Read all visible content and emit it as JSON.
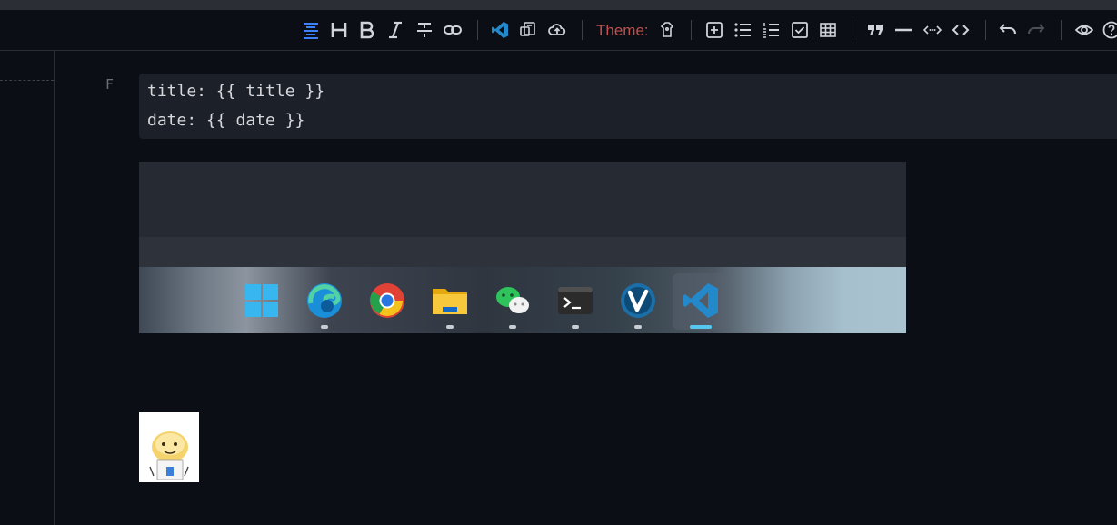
{
  "toolbar": {
    "theme_label": "Theme:",
    "buttons": [
      "align-center-icon",
      "heading-icon",
      "bold-icon",
      "italic-icon",
      "strikethrough-icon",
      "link-icon",
      "vscode-icon",
      "export-icon",
      "upload-cloud-icon",
      "theme-icon",
      "add-snippet-icon",
      "bullet-list-icon",
      "numbered-list-icon",
      "checkbox-icon",
      "table-icon",
      "quote-icon",
      "horizontal-rule-icon",
      "inline-code-icon",
      "code-block-icon",
      "undo-icon",
      "redo-icon",
      "preview-eye-icon",
      "help-icon"
    ]
  },
  "editor": {
    "gutter_marker": "F",
    "code_lines": [
      "title: {{ title }}",
      "date: {{ date }}"
    ]
  },
  "taskbar_image": {
    "apps": [
      {
        "name": "windows-start-icon"
      },
      {
        "name": "edge-icon"
      },
      {
        "name": "chrome-icon"
      },
      {
        "name": "file-explorer-icon"
      },
      {
        "name": "wechat-icon"
      },
      {
        "name": "terminal-icon"
      },
      {
        "name": "vivaldi-icon"
      },
      {
        "name": "vscode-app-icon"
      }
    ]
  },
  "colors": {
    "background": "#0b0e15",
    "code_bg": "#1c2028",
    "theme_label": "#c0504d",
    "active_icon": "#3b82f6",
    "vscode_blue": "#2489ca"
  }
}
